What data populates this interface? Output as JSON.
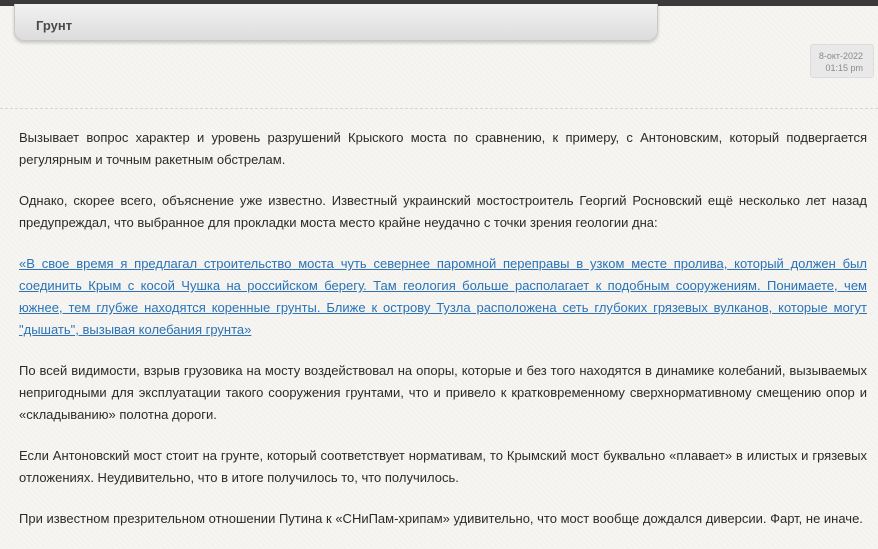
{
  "post": {
    "title": "Грунт",
    "date": "8-окт-2022",
    "time": "01:15 pm"
  },
  "article": {
    "paragraphs": [
      "Вызывает вопрос характер и уровень разрушений Крыского моста по сравнению, к примеру, с Антоновским, который подвергается регулярным и точным ракетным обстрелам.",
      "Однако, скорее всего, объяснение уже известно. Известный украинский мостостроитель Георгий Росновский ещё несколько лет назад предупреждал, что выбранное для прокладки моста место крайне неудачно с точки зрения геологии дна:",
      "«В свое время я предлагал строительство моста чуть севернее паромной переправы в узком месте пролива, который должен был соединить Крым с косой Чушка на российском берегу. Там геология больше располагает к подобным сооружениям. Понимаете, чем южнее, тем глубже находятся коренные грунты. Ближе к острову Тузла расположена сеть глубоких грязевых вулканов, которые могут \"дышать\", вызывая колебания грунта»",
      "По всей видимости, взрыв грузовика на мосту воздействовал на опоры, которые и без того находятся в динамике колебаний, вызываемых непригодными для эксплуатации такого сооружения грунтами, что и привело к кратковременному сверхнормативному смещению опор и «складыванию» полотна дороги.",
      "Если Антоновский мост стоит на грунте, который соответствует нормативам, то Крымский мост буквально «плавает» в илистых и грязевых отложениях. Неудивительно, что в итоге получилось то, что получилось.",
      "При известном презрительном отношении Путина к «СНиПам-хрипам» удивительно, что мост вообще дождался диверсии. Фарт, не иначе."
    ]
  }
}
